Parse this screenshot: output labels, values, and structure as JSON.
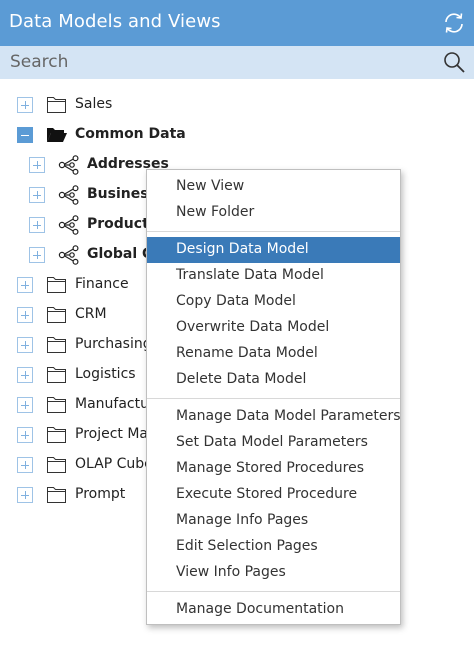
{
  "header": {
    "title": "Data Models and Views",
    "refresh_icon": "refresh-icon",
    "bg": "#5b9bd5"
  },
  "search": {
    "placeholder": "Search",
    "icon": "search-icon"
  },
  "tree": [
    {
      "label": "Sales",
      "level": 0,
      "icon": "folder-icon",
      "expanded": false,
      "bold": false
    },
    {
      "label": "Common Data",
      "level": 0,
      "icon": "folder-open-icon",
      "expanded": true,
      "bold": true
    },
    {
      "label": "Addresses",
      "level": 1,
      "icon": "share-model-icon",
      "expanded": false,
      "bold": true
    },
    {
      "label": "Business",
      "level": 1,
      "icon": "share-model-icon",
      "expanded": false,
      "bold": true
    },
    {
      "label": "Products",
      "level": 1,
      "icon": "share-model-icon",
      "expanded": false,
      "bold": true
    },
    {
      "label": "Global Cu",
      "level": 1,
      "icon": "share-model-icon",
      "expanded": false,
      "bold": true
    },
    {
      "label": "Finance",
      "level": 0,
      "icon": "folder-icon",
      "expanded": false,
      "bold": false
    },
    {
      "label": "CRM",
      "level": 0,
      "icon": "folder-icon",
      "expanded": false,
      "bold": false
    },
    {
      "label": "Purchasing",
      "level": 0,
      "icon": "folder-icon",
      "expanded": false,
      "bold": false
    },
    {
      "label": "Logistics",
      "level": 0,
      "icon": "folder-icon",
      "expanded": false,
      "bold": false
    },
    {
      "label": "Manufactur",
      "level": 0,
      "icon": "folder-icon",
      "expanded": false,
      "bold": false
    },
    {
      "label": "Project Mar",
      "level": 0,
      "icon": "folder-icon",
      "expanded": false,
      "bold": false
    },
    {
      "label": "OLAP Cube",
      "level": 0,
      "icon": "folder-icon",
      "expanded": false,
      "bold": false
    },
    {
      "label": "Prompt",
      "level": 0,
      "icon": "folder-icon",
      "expanded": false,
      "bold": false
    }
  ],
  "context_menu": {
    "groups": [
      [
        "New View",
        "New Folder"
      ],
      [
        "Design Data Model",
        "Translate Data Model",
        "Copy Data Model",
        "Overwrite Data Model",
        "Rename Data Model",
        "Delete Data Model"
      ],
      [
        "Manage Data Model Parameters",
        "Set Data Model Parameters",
        "Manage Stored Procedures",
        "Execute Stored Procedure",
        "Manage Info Pages",
        "Edit Selection Pages",
        "View Info Pages"
      ],
      [
        "Manage Documentation"
      ]
    ],
    "selected": "Design Data Model",
    "selected_color": "#3a7ab8"
  }
}
